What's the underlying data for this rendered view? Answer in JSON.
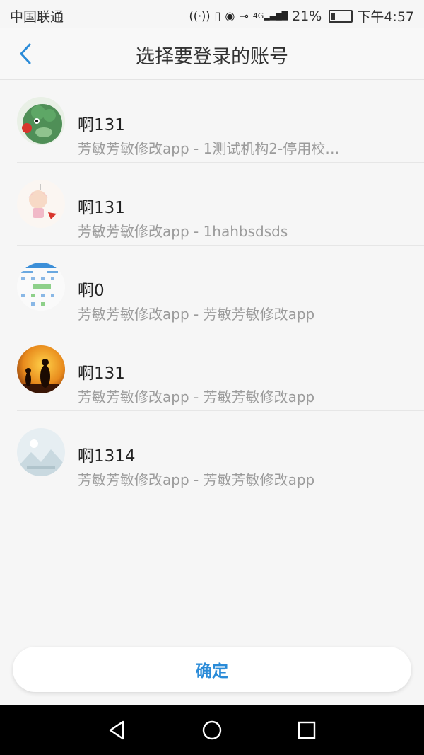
{
  "status_bar": {
    "carrier": "中国联通",
    "battery_percent": "21%",
    "battery_level": 0.21,
    "time": "下午4:57",
    "network": "4G"
  },
  "nav": {
    "title": "选择要登录的账号",
    "back_icon": "chevron-left-icon"
  },
  "accounts": [
    {
      "name": "啊131",
      "subtitle": "芳敏芳敏修改app - 1测试机构2-停用校…",
      "avatar": "green-dinosaur-avatar"
    },
    {
      "name": "啊131",
      "subtitle": "芳敏芳敏修改app - 1hahbsdsds",
      "avatar": "cartoon-girl-avatar"
    },
    {
      "name": "啊0",
      "subtitle": "芳敏芳敏修改app - 芳敏芳敏修改app",
      "avatar": "app-screenshot-avatar"
    },
    {
      "name": "啊131",
      "subtitle": "芳敏芳敏修改app - 芳敏芳敏修改app",
      "avatar": "sunset-silhouette-avatar"
    },
    {
      "name": "啊1314",
      "subtitle": "芳敏芳敏修改app - 芳敏芳敏修改app",
      "avatar": "default-image-avatar"
    }
  ],
  "confirm_button": {
    "label": "确定"
  },
  "colors": {
    "accent": "#2a8bd8",
    "subtitle": "#9b9b9b"
  }
}
